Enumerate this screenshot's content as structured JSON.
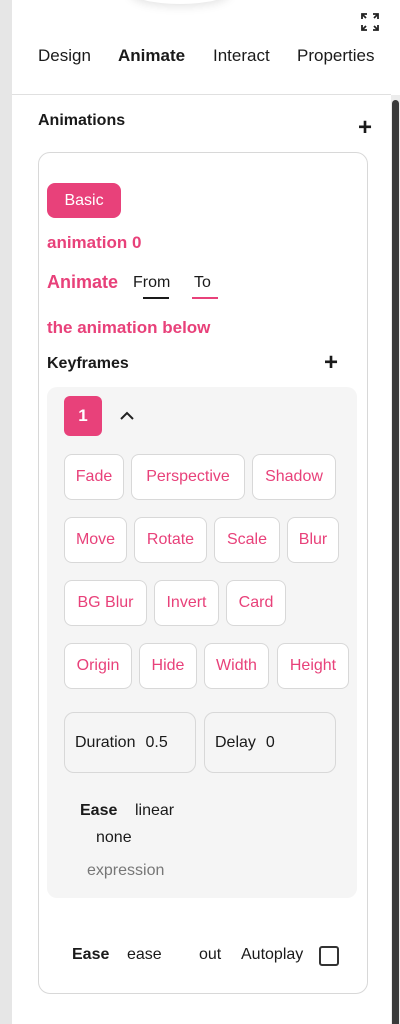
{
  "tabs": [
    {
      "label": "Design",
      "active": false
    },
    {
      "label": "Animate",
      "active": true
    },
    {
      "label": "Interact",
      "active": false
    },
    {
      "label": "Properties",
      "active": false
    }
  ],
  "icons": {
    "expand": "expand-icon",
    "add": "plus-icon",
    "collapse": "chevron-up-icon"
  },
  "colors": {
    "accent": "#e8417a",
    "text": "#1a1a1a",
    "muted": "#777777",
    "panel": "#f5f5f5",
    "border": "#d8d8d8"
  },
  "animations": {
    "title": "Animations",
    "add_label": "+",
    "type_badge": "Basic",
    "name": "animation 0",
    "animate_label": "Animate",
    "from_label": "From",
    "to_label": "To",
    "description": "the animation below",
    "keyframes_title": "Keyframes",
    "keyframes_add_label": "+",
    "keyframe": {
      "index": "1",
      "properties": [
        "Fade",
        "Perspective",
        "Shadow",
        "Move",
        "Rotate",
        "Scale",
        "Blur",
        "BG Blur",
        "Invert",
        "Card",
        "Origin",
        "Hide",
        "Width",
        "Height"
      ],
      "duration_label": "Duration",
      "duration_value": "0.5",
      "delay_label": "Delay",
      "delay_value": "0",
      "ease_label": "Ease",
      "ease_value_1": "linear",
      "ease_value_2": "none",
      "ease_hint": "expression"
    },
    "footer": {
      "ease_label": "Ease",
      "ease_value_1": "ease",
      "ease_value_2": "out",
      "autoplay_label": "Autoplay",
      "autoplay_checked": false
    }
  }
}
